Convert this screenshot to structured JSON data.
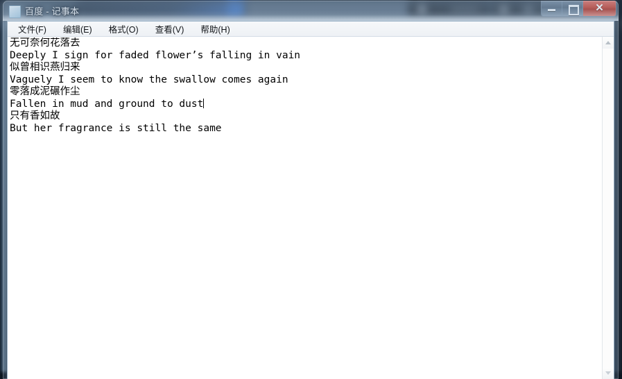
{
  "window": {
    "title": "百度 - 记事本",
    "icon": "notepad-document-icon",
    "controls": {
      "minimize_label": "—",
      "maximize_label": "❐",
      "close_label": "✕"
    }
  },
  "menubar": {
    "items": [
      {
        "label": "文件(F)",
        "name": "file"
      },
      {
        "label": "编辑(E)",
        "name": "edit"
      },
      {
        "label": "格式(O)",
        "name": "format"
      },
      {
        "label": "查看(V)",
        "name": "view"
      },
      {
        "label": "帮助(H)",
        "name": "help"
      }
    ]
  },
  "editor": {
    "lines": [
      "无可奈何花落去",
      "Deeply I sign for faded flower’s falling in vain",
      "似曾相识燕归来",
      "Vaguely I seem to know the swallow comes again",
      "零落成泥碾作尘",
      "Fallen in mud and ground to dust",
      "只有香如故",
      "But her fragrance is still the same"
    ],
    "caret_after_line_index": 5,
    "text_before_caret": "Fallen in mud and ground to dust"
  },
  "scrollbar": {
    "up_arrow": "scroll-up-arrow",
    "down_arrow": "scroll-down-arrow"
  },
  "colors": {
    "close_button": "#c43a2a",
    "text": "#000000",
    "editor_background": "#ffffff",
    "menubar_background": "#f2f5f8"
  }
}
